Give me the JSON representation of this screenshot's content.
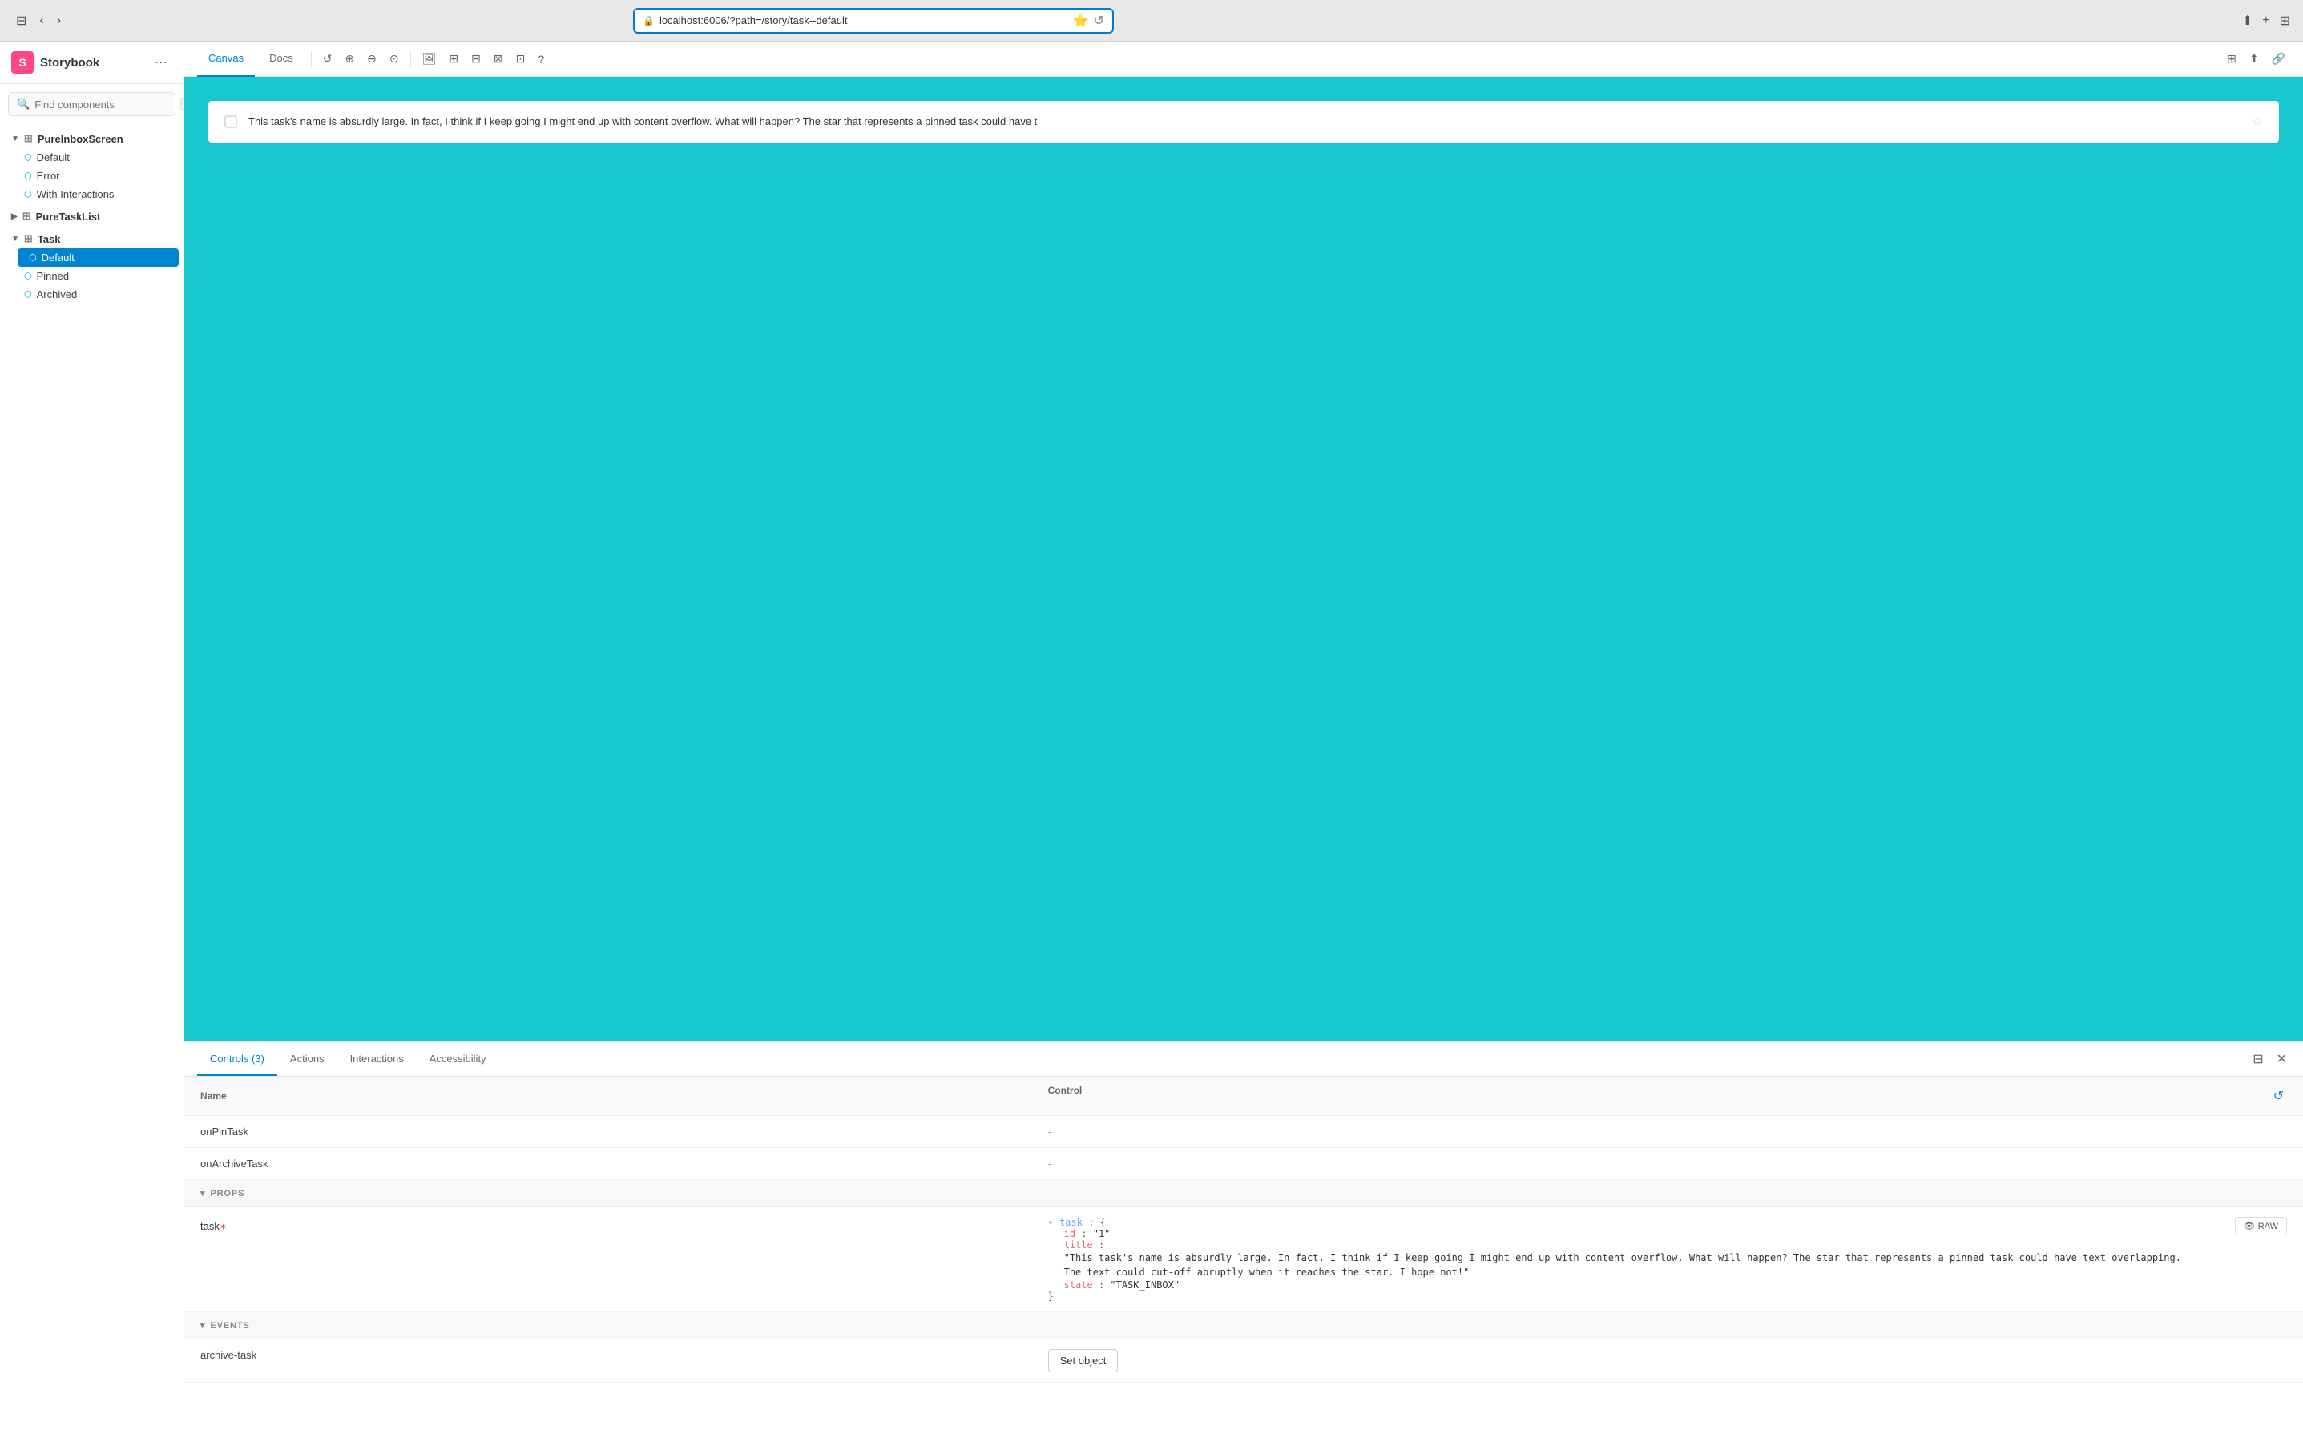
{
  "browser": {
    "url": "localhost:6006/?path=/story/task--default",
    "back_disabled": false,
    "forward_disabled": false
  },
  "sidebar": {
    "logo_text": "S",
    "title": "Storybook",
    "menu_icon": "⋯",
    "search_placeholder": "Find components",
    "search_shortcut": "/",
    "tree": [
      {
        "id": "PureInboxScreen",
        "label": "PureInboxScreen",
        "type": "group",
        "expanded": true,
        "children": [
          {
            "id": "pis-default",
            "label": "Default",
            "type": "story"
          },
          {
            "id": "pis-error",
            "label": "Error",
            "type": "story"
          },
          {
            "id": "pis-interactions",
            "label": "With Interactions",
            "type": "story"
          }
        ]
      },
      {
        "id": "PureTaskList",
        "label": "PureTaskList",
        "type": "group",
        "expanded": false,
        "children": []
      },
      {
        "id": "Task",
        "label": "Task",
        "type": "group",
        "expanded": true,
        "children": [
          {
            "id": "task-default",
            "label": "Default",
            "type": "story",
            "active": true
          },
          {
            "id": "task-pinned",
            "label": "Pinned",
            "type": "story"
          },
          {
            "id": "task-archived",
            "label": "Archived",
            "type": "story"
          }
        ]
      }
    ]
  },
  "toolbar": {
    "tabs": [
      {
        "id": "canvas",
        "label": "Canvas",
        "active": true
      },
      {
        "id": "docs",
        "label": "Docs",
        "active": false
      }
    ]
  },
  "canvas": {
    "task_text": "This task's name is absurdly large. In fact, I think if I keep going I might end up with content overflow. What will happen? The star that represents a pinned task could have t"
  },
  "bottom_panel": {
    "tabs": [
      {
        "id": "controls",
        "label": "Controls (3)",
        "active": true
      },
      {
        "id": "actions",
        "label": "Actions",
        "active": false
      },
      {
        "id": "interactions",
        "label": "Interactions",
        "active": false
      },
      {
        "id": "accessibility",
        "label": "Accessibility",
        "active": false
      }
    ],
    "controls_header": {
      "name_col": "Name",
      "control_col": "Control"
    },
    "rows": [
      {
        "name": "onPinTask",
        "control": "-",
        "type": "event"
      },
      {
        "name": "onArchiveTask",
        "control": "-",
        "type": "event"
      }
    ],
    "props_section": "PROPS",
    "events_section": "EVENTS",
    "task_prop": {
      "label": "task",
      "required": true,
      "code": {
        "var_name": "task",
        "id_key": "id",
        "id_val": "\"1\"",
        "title_key": "title",
        "title_val": "\"This task's name is absurdly large. In fact, I think if I keep going I might end up with content overflow. What will happen? The star that represents a pinned task could have text overlapping. The text could cut-off abruptly when it reaches the star. I hope not!\"",
        "state_key": "state",
        "state_val": "\"TASK_INBOX\""
      }
    },
    "archive_task_event": {
      "label": "archive-task",
      "button_label": "Set object"
    }
  }
}
